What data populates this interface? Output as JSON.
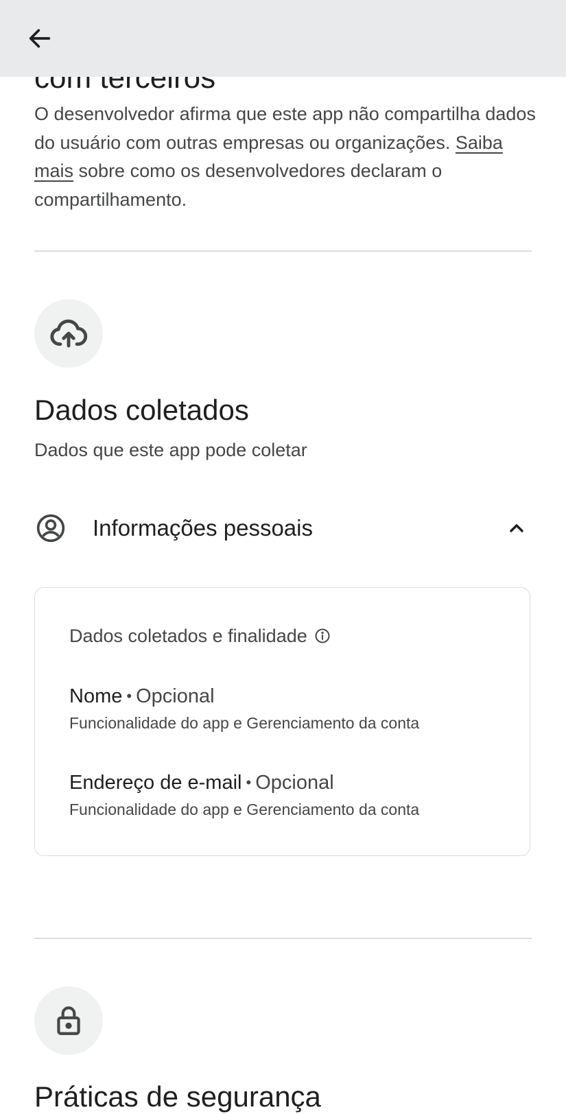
{
  "app_bar": {
    "back_icon": "arrow-back-icon"
  },
  "sharing_section": {
    "partial_heading": "com terceiros",
    "description_part1": "O desenvolvedor afirma que este app não compartilha dados do usuário com outras empresas ou organizações.",
    "link_label": "Saiba mais",
    "description_part2": "sobre como os desenvolvedores declaram o compartilhamento."
  },
  "collected_section": {
    "icon": "cloud-upload-icon",
    "title": "Dados coletados",
    "subtitle": "Dados que este app pode coletar",
    "category": {
      "icon": "account-circle-icon",
      "label": "Informações pessoais",
      "chevron": "chevron-up-icon",
      "expanded": true
    },
    "card": {
      "header": "Dados coletados e finalidade",
      "info_icon": "info-icon",
      "items": [
        {
          "name": "Nome",
          "separator": "•",
          "status": "Opcional",
          "purpose": "Funcionalidade do app e Gerenciamento da conta"
        },
        {
          "name": "Endereço de e-mail",
          "separator": "•",
          "status": "Opcional",
          "purpose": "Funcionalidade do app e Gerenciamento da conta"
        }
      ]
    }
  },
  "security_section": {
    "icon": "lock-icon",
    "partial_title": "Práticas de segurança"
  },
  "colors": {
    "app_bar_bg": "#e8eaec",
    "text_primary": "#1f1f1f",
    "text_secondary": "#444746",
    "divider": "#dadce0",
    "icon_circle_bg": "#f0f1f1"
  }
}
